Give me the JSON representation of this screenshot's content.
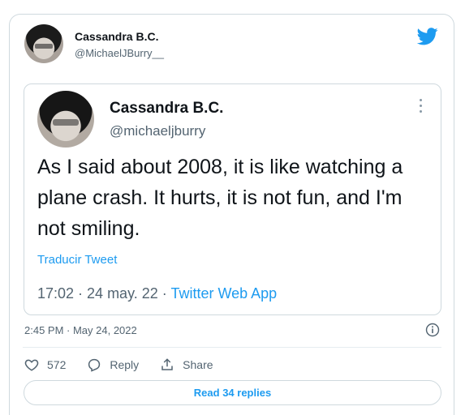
{
  "tweet": {
    "author_name": "Cassandra B.C.",
    "author_handle": "@MichaelJBurry__",
    "timestamp": "2:45 PM · May 24, 2022",
    "likes": "572",
    "reply_label": "Reply",
    "share_label": "Share",
    "read_replies_label": "Read 34 replies"
  },
  "quoted": {
    "author_name": "Cassandra B.C.",
    "author_handle": "@michaeljburry",
    "text": "As I said about 2008, it is like watching a plane crash. It hurts, it is not fun, and I'm not smiling.",
    "translate_label": "Traducir Tweet",
    "datetime": "17:02 · 24 may. 22 · ",
    "source_app": "Twitter Web App"
  },
  "colors": {
    "accent": "#1d9bf0",
    "text": "#0f1419",
    "muted": "#536471",
    "border": "#cfd9de"
  },
  "icons": [
    "twitter-bird-icon",
    "more-options-icon",
    "info-icon",
    "heart-icon",
    "reply-icon",
    "share-icon"
  ]
}
